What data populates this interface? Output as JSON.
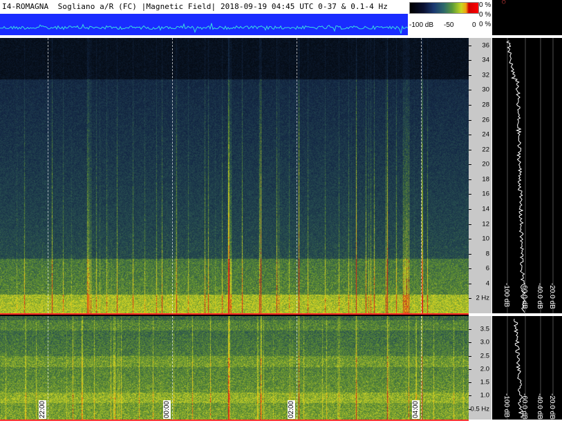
{
  "header": {
    "title": "I4-ROMAGNA  Sogliano a/R (FC) |Magnetic Field| 2018-09-19 04:45 UTC 0-37 & 0.1-4 Hz"
  },
  "colorbar": {
    "left_label": "-100 dB",
    "mid_label": "-50",
    "right_label": "0",
    "pct_labels": [
      "0 %",
      "0 %",
      "0 %"
    ]
  },
  "colors": {
    "background": "#071018",
    "waveform_bg": "#1a2cff",
    "waveform": "#38e0e0",
    "red_line": "#ff2a2a",
    "profile_line": "#ffffff"
  },
  "top_axis": {
    "labels": [
      "36",
      "34",
      "32",
      "30",
      "28",
      "26",
      "24",
      "22",
      "20",
      "18",
      "16",
      "14",
      "12",
      "10",
      "8",
      "6",
      "4",
      "2 Hz"
    ],
    "values": [
      36,
      34,
      32,
      30,
      28,
      26,
      24,
      22,
      20,
      18,
      16,
      14,
      12,
      10,
      8,
      6,
      4,
      2
    ],
    "range": [
      0,
      37
    ]
  },
  "bottom_axis": {
    "labels": [
      "3.5",
      "3.0",
      "2.5",
      "2.0",
      "1.5",
      "1.0",
      "0.5 Hz"
    ],
    "values": [
      3.5,
      3.0,
      2.5,
      2.0,
      1.5,
      1.0,
      0.5
    ],
    "range": [
      0.1,
      4
    ]
  },
  "time_labels": [
    "22:00",
    "00:00",
    "02:00",
    "04:00"
  ],
  "profile": {
    "db_labels": [
      "-100 dB",
      "-60.0 dB",
      "-40.0 dB",
      "-20.0 dB"
    ]
  }
}
